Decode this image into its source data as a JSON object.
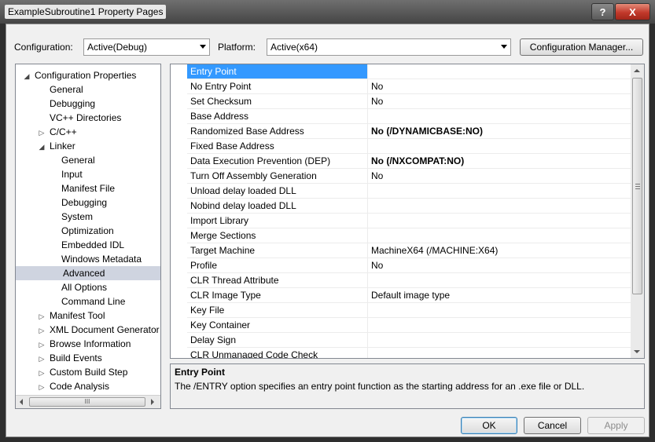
{
  "window": {
    "title": "ExampleSubroutine1 Property Pages",
    "help_label": "?",
    "close_label": "X"
  },
  "toolbar": {
    "configuration_label": "Configuration:",
    "configuration_value": "Active(Debug)",
    "platform_label": "Platform:",
    "platform_value": "Active(x64)",
    "config_manager_label": "Configuration Manager..."
  },
  "tree": {
    "items": [
      {
        "label": "Configuration Properties",
        "expander": "◢",
        "level": 0
      },
      {
        "label": "General",
        "expander": "",
        "level": 1
      },
      {
        "label": "Debugging",
        "expander": "",
        "level": 1
      },
      {
        "label": "VC++ Directories",
        "expander": "",
        "level": 1
      },
      {
        "label": "C/C++",
        "expander": "▷",
        "level": 1
      },
      {
        "label": "Linker",
        "expander": "◢",
        "level": 1
      },
      {
        "label": "General",
        "expander": "",
        "level": 2
      },
      {
        "label": "Input",
        "expander": "",
        "level": 2
      },
      {
        "label": "Manifest File",
        "expander": "",
        "level": 2
      },
      {
        "label": "Debugging",
        "expander": "",
        "level": 2
      },
      {
        "label": "System",
        "expander": "",
        "level": 2
      },
      {
        "label": "Optimization",
        "expander": "",
        "level": 2
      },
      {
        "label": "Embedded IDL",
        "expander": "",
        "level": 2
      },
      {
        "label": "Windows Metadata",
        "expander": "",
        "level": 2
      },
      {
        "label": "Advanced",
        "expander": "",
        "level": 2,
        "selected": true
      },
      {
        "label": "All Options",
        "expander": "",
        "level": 2
      },
      {
        "label": "Command Line",
        "expander": "",
        "level": 2
      },
      {
        "label": "Manifest Tool",
        "expander": "▷",
        "level": 1
      },
      {
        "label": "XML Document Generator",
        "expander": "▷",
        "level": 1
      },
      {
        "label": "Browse Information",
        "expander": "▷",
        "level": 1
      },
      {
        "label": "Build Events",
        "expander": "▷",
        "level": 1
      },
      {
        "label": "Custom Build Step",
        "expander": "▷",
        "level": 1
      },
      {
        "label": "Code Analysis",
        "expander": "▷",
        "level": 1
      }
    ],
    "hscroll_grip": "III"
  },
  "properties": [
    {
      "name": "Entry Point",
      "value": "",
      "selected": true
    },
    {
      "name": "No Entry Point",
      "value": "No"
    },
    {
      "name": "Set Checksum",
      "value": "No"
    },
    {
      "name": "Base Address",
      "value": ""
    },
    {
      "name": "Randomized Base Address",
      "value": "No (/DYNAMICBASE:NO)",
      "bold": true
    },
    {
      "name": "Fixed Base Address",
      "value": ""
    },
    {
      "name": "Data Execution Prevention (DEP)",
      "value": "No (/NXCOMPAT:NO)",
      "bold": true
    },
    {
      "name": "Turn Off Assembly Generation",
      "value": "No"
    },
    {
      "name": "Unload delay loaded DLL",
      "value": ""
    },
    {
      "name": "Nobind delay loaded DLL",
      "value": ""
    },
    {
      "name": "Import Library",
      "value": ""
    },
    {
      "name": "Merge Sections",
      "value": ""
    },
    {
      "name": "Target Machine",
      "value": "MachineX64 (/MACHINE:X64)"
    },
    {
      "name": "Profile",
      "value": "No"
    },
    {
      "name": "CLR Thread Attribute",
      "value": ""
    },
    {
      "name": "CLR Image Type",
      "value": "Default image type"
    },
    {
      "name": "Key File",
      "value": ""
    },
    {
      "name": "Key Container",
      "value": ""
    },
    {
      "name": "Delay Sign",
      "value": ""
    },
    {
      "name": "CLR Unmanaged Code Check",
      "value": ""
    }
  ],
  "description": {
    "title": "Entry Point",
    "text": "The /ENTRY option specifies an entry point function as the starting address for an .exe file or DLL."
  },
  "buttons": {
    "ok": "OK",
    "cancel": "Cancel",
    "apply": "Apply"
  },
  "colors": {
    "selection": "#3399ff",
    "tree_selection": "#cfd4e0",
    "close_button": "#c2392b"
  }
}
